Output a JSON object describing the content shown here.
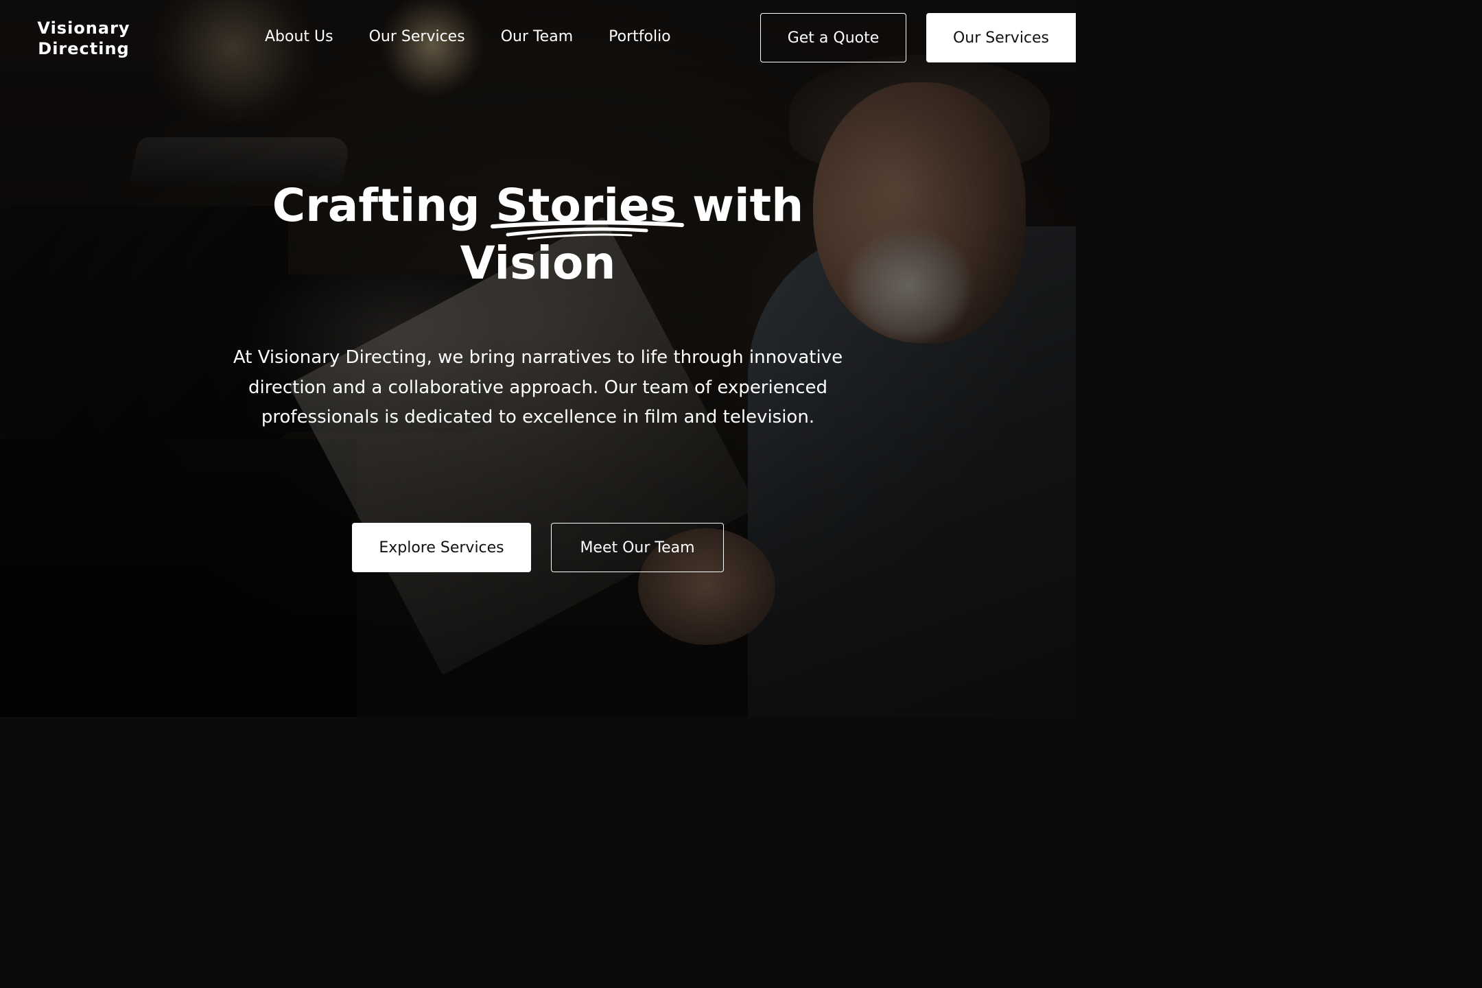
{
  "header": {
    "logo_line1": "Visionary",
    "logo_line2": "Directing",
    "nav": [
      {
        "label": "About Us"
      },
      {
        "label": "Our Services"
      },
      {
        "label": "Our Team"
      },
      {
        "label": "Portfolio"
      }
    ],
    "quote_button": "Get a Quote",
    "services_button": "Our Services"
  },
  "hero": {
    "title_before": "Crafting ",
    "title_highlight": "Stories",
    "title_after": " with",
    "title_line2": "Vision",
    "description": "At Visionary Directing, we bring narratives to life through innovative direction and a collaborative approach. Our team of experienced professionals is dedicated to excellence in film and television.",
    "primary_button": "Explore Services",
    "secondary_button": "Meet Our Team"
  },
  "background": {
    "subject": "director-with-script-and-camera-photo"
  },
  "colors": {
    "text": "#ffffff",
    "button_fill": "#ffffff",
    "button_text": "#111111"
  }
}
